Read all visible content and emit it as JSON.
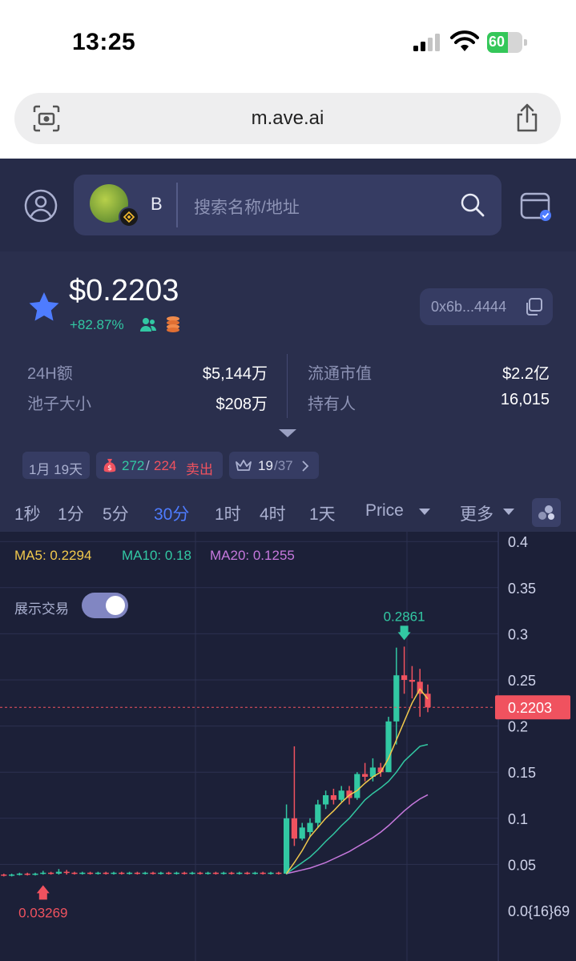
{
  "status_bar": {
    "time": "13:25",
    "battery": "60"
  },
  "browser": {
    "url": "m.ave.ai"
  },
  "header": {
    "chain_letter": "B",
    "search_placeholder": "搜索名称/地址"
  },
  "token": {
    "price": "$0.2203",
    "change": "+82.87%",
    "address": "0x6b...4444"
  },
  "stats": {
    "vol_label": "24H额",
    "vol_value": "$5,144万",
    "mcap_label": "流通市值",
    "mcap_value": "$2.2亿",
    "pool_label": "池子大小",
    "pool_value": "$208万",
    "holders_label": "持有人",
    "holders_value": "16,015"
  },
  "chips": {
    "age": "1月 19天",
    "buys": "272",
    "sep": "/",
    "sells": "224",
    "sell_label": "卖出",
    "rank": "19",
    "rank_total": "/37"
  },
  "intervals": [
    "1秒",
    "1分",
    "5分",
    "30分",
    "1时",
    "4时",
    "1天"
  ],
  "active_interval": "30分",
  "price_dropdown": "Price",
  "more_dropdown": "更多",
  "chart_labels": {
    "ma5": "MA5: 0.2294",
    "ma10": "MA10: 0.18",
    "ma20": "MA20: 0.1255",
    "toggle_label": "展示交易"
  },
  "colors": {
    "up": "#32c8a3",
    "down": "#f0525f",
    "accent": "#4e7cff",
    "ma5": "#f2c94c",
    "ma10": "#32c8a3",
    "ma20": "#c678dd"
  },
  "chart_data": {
    "type": "candlestick",
    "y_ticks": [
      "0.4",
      "0.35",
      "0.3",
      "0.25",
      "0.2",
      "0.15",
      "0.1",
      "0.05",
      "0.0{16}69"
    ],
    "y_tick_values": [
      0.4,
      0.35,
      0.3,
      0.25,
      0.2,
      0.15,
      0.1,
      0.05,
      0.0
    ],
    "current_price": 0.2203,
    "current_price_label": "0.2203",
    "high_marker": {
      "value": 0.2861,
      "label": "0.2861"
    },
    "low_marker": {
      "value": 0.03269,
      "label": "0.03269"
    },
    "candles": [
      [
        0.038,
        0.039,
        0.037,
        0.04
      ],
      [
        0.039,
        0.038,
        0.037,
        0.04
      ],
      [
        0.038,
        0.039,
        0.037,
        0.04
      ],
      [
        0.039,
        0.04,
        0.038,
        0.041
      ],
      [
        0.04,
        0.039,
        0.038,
        0.041
      ],
      [
        0.039,
        0.04,
        0.038,
        0.041
      ],
      [
        0.04,
        0.041,
        0.039,
        0.043
      ],
      [
        0.041,
        0.04,
        0.039,
        0.042
      ],
      [
        0.04,
        0.042,
        0.039,
        0.045
      ],
      [
        0.042,
        0.041,
        0.039,
        0.044
      ],
      [
        0.041,
        0.04,
        0.039,
        0.042
      ],
      [
        0.04,
        0.041,
        0.039,
        0.042
      ],
      [
        0.041,
        0.04,
        0.039,
        0.042
      ],
      [
        0.04,
        0.041,
        0.039,
        0.042
      ],
      [
        0.041,
        0.04,
        0.039,
        0.042
      ],
      [
        0.04,
        0.041,
        0.039,
        0.042
      ],
      [
        0.041,
        0.04,
        0.039,
        0.042
      ],
      [
        0.04,
        0.041,
        0.039,
        0.042
      ],
      [
        0.041,
        0.04,
        0.039,
        0.042
      ],
      [
        0.04,
        0.041,
        0.039,
        0.042
      ],
      [
        0.041,
        0.04,
        0.039,
        0.042
      ],
      [
        0.04,
        0.041,
        0.039,
        0.042
      ],
      [
        0.041,
        0.04,
        0.039,
        0.042
      ],
      [
        0.04,
        0.041,
        0.039,
        0.042
      ],
      [
        0.041,
        0.04,
        0.039,
        0.042
      ],
      [
        0.04,
        0.041,
        0.039,
        0.042
      ],
      [
        0.041,
        0.04,
        0.039,
        0.042
      ],
      [
        0.04,
        0.041,
        0.039,
        0.042
      ],
      [
        0.041,
        0.04,
        0.039,
        0.042
      ],
      [
        0.04,
        0.041,
        0.039,
        0.042
      ],
      [
        0.041,
        0.04,
        0.039,
        0.042
      ],
      [
        0.04,
        0.041,
        0.039,
        0.042
      ],
      [
        0.041,
        0.04,
        0.039,
        0.042
      ],
      [
        0.04,
        0.041,
        0.039,
        0.042
      ],
      [
        0.041,
        0.04,
        0.039,
        0.042
      ],
      [
        0.04,
        0.041,
        0.039,
        0.042
      ],
      [
        0.041,
        0.04,
        0.039,
        0.042
      ],
      [
        0.04,
        0.1,
        0.039,
        0.115
      ],
      [
        0.1,
        0.078,
        0.07,
        0.178
      ],
      [
        0.078,
        0.09,
        0.076,
        0.095
      ],
      [
        0.085,
        0.095,
        0.08,
        0.1
      ],
      [
        0.095,
        0.115,
        0.09,
        0.12
      ],
      [
        0.115,
        0.125,
        0.11,
        0.13
      ],
      [
        0.125,
        0.12,
        0.115,
        0.132
      ],
      [
        0.12,
        0.13,
        0.118,
        0.135
      ],
      [
        0.13,
        0.122,
        0.115,
        0.135
      ],
      [
        0.122,
        0.148,
        0.12,
        0.15
      ],
      [
        0.148,
        0.145,
        0.14,
        0.16
      ],
      [
        0.145,
        0.155,
        0.14,
        0.165
      ],
      [
        0.155,
        0.15,
        0.145,
        0.16
      ],
      [
        0.15,
        0.205,
        0.15,
        0.21
      ],
      [
        0.205,
        0.255,
        0.18,
        0.285
      ],
      [
        0.255,
        0.25,
        0.235,
        0.2861
      ],
      [
        0.25,
        0.248,
        0.23,
        0.265
      ],
      [
        0.248,
        0.235,
        0.21,
        0.262
      ],
      [
        0.235,
        0.2203,
        0.215,
        0.245
      ]
    ],
    "ma5": [
      0.04,
      0.052,
      0.065,
      0.08,
      0.09,
      0.1,
      0.108,
      0.117,
      0.125,
      0.13,
      0.138,
      0.145,
      0.15,
      0.165,
      0.185,
      0.205,
      0.225,
      0.24,
      0.2294
    ],
    "ma10": [
      0.04,
      0.046,
      0.052,
      0.058,
      0.066,
      0.075,
      0.083,
      0.092,
      0.1,
      0.11,
      0.12,
      0.127,
      0.133,
      0.14,
      0.15,
      0.162,
      0.17,
      0.178,
      0.18
    ],
    "ma20": [
      0.04,
      0.042,
      0.044,
      0.046,
      0.049,
      0.052,
      0.056,
      0.06,
      0.064,
      0.069,
      0.074,
      0.079,
      0.085,
      0.092,
      0.1,
      0.108,
      0.115,
      0.121,
      0.1255
    ]
  }
}
